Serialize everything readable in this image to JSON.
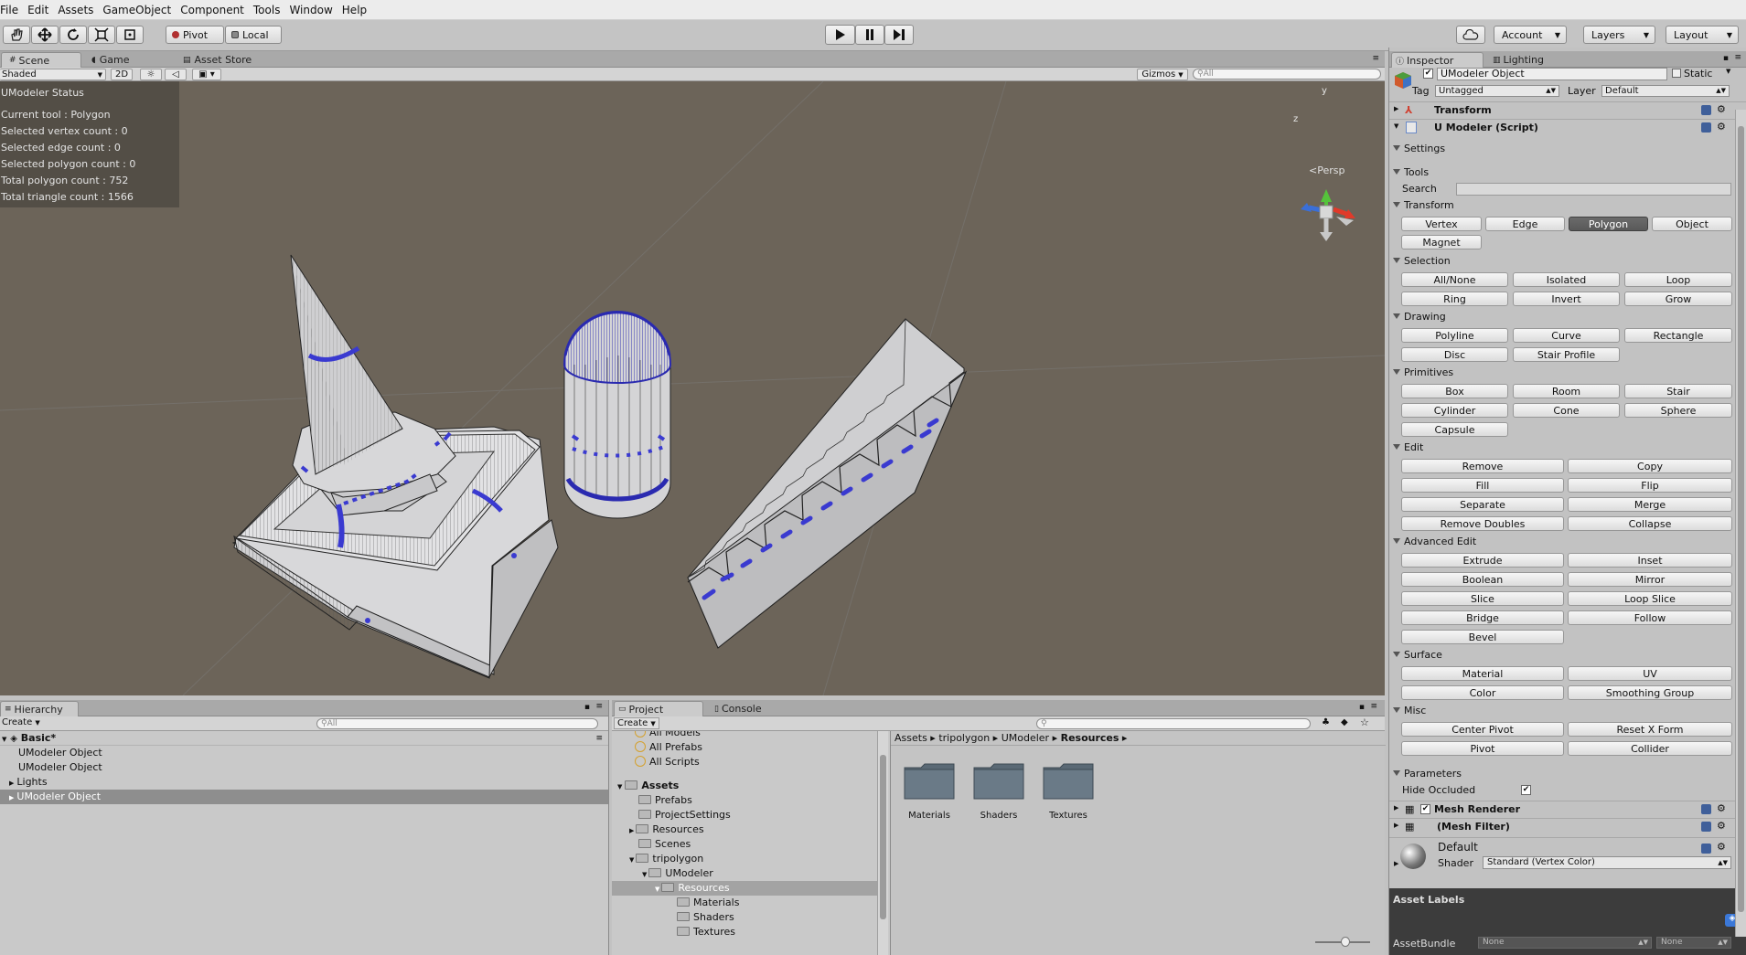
{
  "menu": [
    "File",
    "Edit",
    "Assets",
    "GameObject",
    "Component",
    "Tools",
    "Window",
    "Help"
  ],
  "toolbar": {
    "pivot": "Pivot",
    "local": "Local",
    "account": "Account",
    "layers": "Layers",
    "layout": "Layout"
  },
  "scene": {
    "tabs": [
      "Scene",
      "Game",
      "Asset Store"
    ],
    "shading": "Shaded",
    "mode_2d": "2D",
    "gizmos": "Gizmos",
    "search_placeholder": "All",
    "persp": "Persp",
    "gizmo_y": "y",
    "gizmo_z": "z",
    "status": {
      "title": "UModeler Status",
      "lines": [
        "Current tool : Polygon",
        "Selected vertex count : 0",
        "Selected edge count : 0",
        "Selected polygon count : 0",
        "Total polygon  count : 752",
        "Total triangle count : 1566"
      ]
    }
  },
  "hierarchy": {
    "tab": "Hierarchy",
    "create": "Create",
    "search_placeholder": "All",
    "scene_name": "Basic*",
    "items": [
      "UModeler Object",
      "UModeler Object",
      "Lights",
      "UModeler Object"
    ]
  },
  "project": {
    "tabs": [
      "Project",
      "Console"
    ],
    "create": "Create",
    "favorites": [
      "All Models",
      "All Prefabs",
      "All Scripts"
    ],
    "tree": [
      "Assets",
      "Prefabs",
      "ProjectSettings",
      "Resources",
      "Scenes",
      "tripolygon",
      "UModeler",
      "Resources",
      "Materials",
      "Shaders",
      "Textures"
    ],
    "breadcrumb": [
      "Assets",
      "tripolygon",
      "UModeler",
      "Resources"
    ],
    "folders": [
      "Materials",
      "Shaders",
      "Textures"
    ]
  },
  "inspector": {
    "tabs": [
      "Inspector",
      "Lighting"
    ],
    "object_name": "UModeler Object",
    "static": "Static",
    "tag_label": "Tag",
    "tag_value": "Untagged",
    "layer_label": "Layer",
    "layer_value": "Default",
    "transform": "Transform",
    "script": "U Modeler (Script)",
    "settings": "Settings",
    "tools": "Tools",
    "search_label": "Search",
    "sections": {
      "transform": {
        "title": "Transform",
        "buttons": [
          "Vertex",
          "Edge",
          "Polygon",
          "Object",
          "Magnet"
        ],
        "active": "Polygon"
      },
      "selection": {
        "title": "Selection",
        "buttons": [
          "All/None",
          "Isolated",
          "Loop",
          "Ring",
          "Invert",
          "Grow"
        ]
      },
      "drawing": {
        "title": "Drawing",
        "buttons": [
          "Polyline",
          "Curve",
          "Rectangle",
          "Disc",
          "Stair Profile"
        ]
      },
      "primitives": {
        "title": "Primitives",
        "buttons": [
          "Box",
          "Room",
          "Stair",
          "Cylinder",
          "Cone",
          "Sphere",
          "Capsule"
        ]
      },
      "edit": {
        "title": "Edit",
        "buttons": [
          "Remove",
          "Copy",
          "Fill",
          "Flip",
          "Separate",
          "Merge",
          "Remove Doubles",
          "Collapse"
        ]
      },
      "advanced": {
        "title": "Advanced Edit",
        "buttons": [
          "Extrude",
          "Inset",
          "Boolean",
          "Mirror",
          "Slice",
          "Loop Slice",
          "Bridge",
          "Follow",
          "Bevel"
        ]
      },
      "surface": {
        "title": "Surface",
        "buttons": [
          "Material",
          "UV",
          "Color",
          "Smoothing Group"
        ]
      },
      "misc": {
        "title": "Misc",
        "buttons": [
          "Center Pivot",
          "Reset X Form",
          "Pivot",
          "Collider"
        ]
      }
    },
    "parameters": "Parameters",
    "hide_occluded": "Hide Occluded",
    "mesh_renderer": "Mesh Renderer",
    "mesh_filter": "(Mesh Filter)",
    "material_name": "Default",
    "shader_label": "Shader",
    "shader_value": "Standard (Vertex Color)",
    "asset_labels": "Asset Labels",
    "asset_bundle": "AssetBundle",
    "bundle_value": "None",
    "bundle_variant": "None"
  },
  "colors": {
    "viewport": "#6c6459",
    "selection": "#3a3ad0",
    "active_button": "#5f5f5f"
  }
}
